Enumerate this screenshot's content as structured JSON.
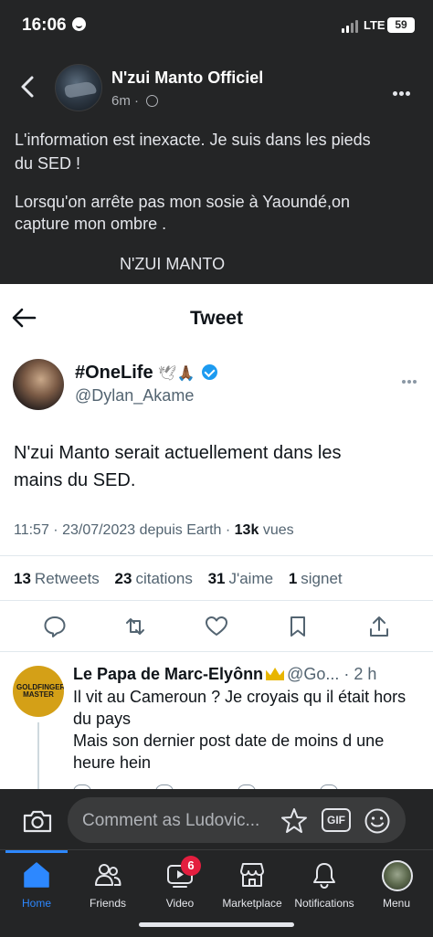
{
  "status_bar": {
    "time": "16:06",
    "network": "LTE",
    "battery": "59"
  },
  "post": {
    "page_name": "N'zui Manto Officiel",
    "age": "6m",
    "caption_lines": [
      "L'information est inexacte. Je suis dans les pieds",
      "du SED !",
      "Lorsqu'on arrête pas mon sosie à Yaoundé,on",
      "capture mon ombre ."
    ],
    "signature": "N'ZUI MANTO"
  },
  "tweet": {
    "header_title": "Tweet",
    "author_name": "#OneLife",
    "author_emoji": "🕊🙏🏾",
    "author_handle": "@Dylan_Akame",
    "text_lines": [
      "N'zui Manto serait actuellement dans les",
      "mains du SED."
    ],
    "timestamp": "11:57 · 23/07/2023 depuis Earth ·",
    "views_count": "13k",
    "views_label": "vues",
    "stats": [
      {
        "count": "13",
        "label": "Retweets"
      },
      {
        "count": "23",
        "label": "citations"
      },
      {
        "count": "31",
        "label": "J'aime"
      },
      {
        "count": "1",
        "label": "signet"
      }
    ],
    "reply": {
      "avatar_text": "GOLDFINGER MASTER",
      "author_name": "Le Papa de Marc-Elyônn",
      "handle": "@Go...",
      "age": "· 2 h",
      "text_lines": [
        "Il vit au Cameroun ? Je croyais qu il était hors",
        "du pays",
        "Mais son dernier post date de moins d une",
        "heure hein"
      ]
    }
  },
  "comment_bar": {
    "placeholder": "Comment as Ludovic...",
    "gif_label": "GIF"
  },
  "tabs": [
    {
      "label": "Home",
      "icon": "home-icon"
    },
    {
      "label": "Friends",
      "icon": "friends-icon"
    },
    {
      "label": "Video",
      "icon": "video-icon"
    },
    {
      "label": "Marketplace",
      "icon": "marketplace-icon"
    },
    {
      "label": "Notifications",
      "icon": "bell-icon"
    },
    {
      "label": "Menu",
      "icon": "avatar"
    }
  ],
  "video_badge": "6",
  "colors": {
    "background": "#242526",
    "accent": "#2d88ff",
    "badge": "#e41e3f",
    "twitter_blue": "#1d9bf0"
  }
}
